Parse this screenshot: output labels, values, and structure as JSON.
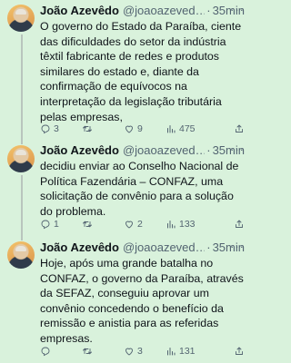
{
  "tweets": [
    {
      "name": "João Azevêdo",
      "handle": "@joaoazeved…",
      "dot": "·",
      "time": "35min",
      "more": "···",
      "text": "O governo do Estado da Paraíba, ciente das dificuldades do setor da indústria têxtil fabricante de redes e produtos similares do estado e, diante da confirmação de equívocos na interpretação da legislação tributária pelas empresas,",
      "replies": "3",
      "retweets": "",
      "likes": "9",
      "views": "475"
    },
    {
      "name": "João Azevêdo",
      "handle": "@joaoazeved…",
      "dot": "·",
      "time": "35min",
      "more": "···",
      "text": "decidiu enviar ao Conselho Nacional de Política Fazendária – CONFAZ, uma solicitação de convênio para a solução do problema.",
      "replies": "1",
      "retweets": "",
      "likes": "2",
      "views": "133"
    },
    {
      "name": "João Azevêdo",
      "handle": "@joaoazeved…",
      "dot": "·",
      "time": "35min",
      "more": "···",
      "text": "Hoje, após uma grande batalha no CONFAZ, o governo da Paraíba, através da SEFAZ, conseguiu aprovar um convênio concedendo o benefício da remissão e anistia para as referidas empresas.",
      "replies": "",
      "retweets": "",
      "likes": "3",
      "views": "131"
    }
  ],
  "icons": {
    "reply": "reply-icon",
    "retweet": "retweet-icon",
    "like": "heart-icon",
    "views": "views-icon",
    "share": "share-icon",
    "more": "more-icon"
  },
  "colors": {
    "background": "#d9f2dc",
    "text": "#0f1419",
    "muted": "#536471",
    "thread_line": "#b9c5bd"
  }
}
